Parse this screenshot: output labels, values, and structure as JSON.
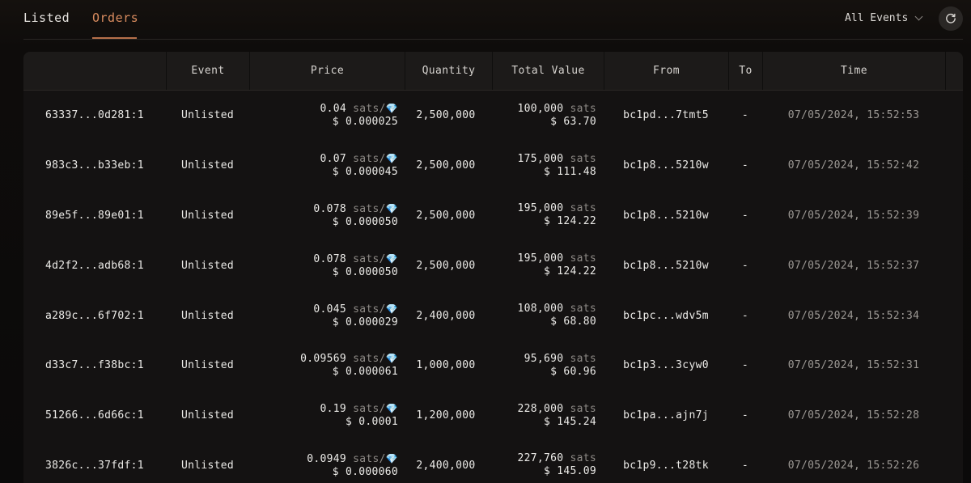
{
  "tabs": [
    {
      "label": "Listed",
      "active": false
    },
    {
      "label": "Orders",
      "active": true
    }
  ],
  "filter": {
    "label": "All Events"
  },
  "colors": {
    "accent": "#d98c5f",
    "underline": "#b6704a",
    "gem": "#7fc3ec"
  },
  "table": {
    "headers": {
      "event": "Event",
      "price": "Price",
      "quantity": "Quantity",
      "total_value": "Total Value",
      "from": "From",
      "to": "To",
      "time": "Time"
    },
    "rows": [
      {
        "id": "63337...0d281:1",
        "event": "Unlisted",
        "price": "0.04",
        "price_unit": "sats/",
        "price_usd": "$ 0.000025",
        "quantity": "2,500,000",
        "total_sats": "100,000",
        "total_unit": "sats",
        "total_usd": "$ 63.70",
        "from": "bc1pd...7tmt5",
        "to": "-",
        "time": "07/05/2024, 15:52:53"
      },
      {
        "id": "983c3...b33eb:1",
        "event": "Unlisted",
        "price": "0.07",
        "price_unit": "sats/",
        "price_usd": "$ 0.000045",
        "quantity": "2,500,000",
        "total_sats": "175,000",
        "total_unit": "sats",
        "total_usd": "$ 111.48",
        "from": "bc1p8...5210w",
        "to": "-",
        "time": "07/05/2024, 15:52:42"
      },
      {
        "id": "89e5f...89e01:1",
        "event": "Unlisted",
        "price": "0.078",
        "price_unit": "sats/",
        "price_usd": "$ 0.000050",
        "quantity": "2,500,000",
        "total_sats": "195,000",
        "total_unit": "sats",
        "total_usd": "$ 124.22",
        "from": "bc1p8...5210w",
        "to": "-",
        "time": "07/05/2024, 15:52:39"
      },
      {
        "id": "4d2f2...adb68:1",
        "event": "Unlisted",
        "price": "0.078",
        "price_unit": "sats/",
        "price_usd": "$ 0.000050",
        "quantity": "2,500,000",
        "total_sats": "195,000",
        "total_unit": "sats",
        "total_usd": "$ 124.22",
        "from": "bc1p8...5210w",
        "to": "-",
        "time": "07/05/2024, 15:52:37"
      },
      {
        "id": "a289c...6f702:1",
        "event": "Unlisted",
        "price": "0.045",
        "price_unit": "sats/",
        "price_usd": "$ 0.000029",
        "quantity": "2,400,000",
        "total_sats": "108,000",
        "total_unit": "sats",
        "total_usd": "$ 68.80",
        "from": "bc1pc...wdv5m",
        "to": "-",
        "time": "07/05/2024, 15:52:34"
      },
      {
        "id": "d33c7...f38bc:1",
        "event": "Unlisted",
        "price": "0.09569",
        "price_unit": "sats/",
        "price_usd": "$ 0.000061",
        "quantity": "1,000,000",
        "total_sats": "95,690",
        "total_unit": "sats",
        "total_usd": "$ 60.96",
        "from": "bc1p3...3cyw0",
        "to": "-",
        "time": "07/05/2024, 15:52:31"
      },
      {
        "id": "51266...6d66c:1",
        "event": "Unlisted",
        "price": "0.19",
        "price_unit": "sats/",
        "price_usd": "$ 0.0001",
        "quantity": "1,200,000",
        "total_sats": "228,000",
        "total_unit": "sats",
        "total_usd": "$ 145.24",
        "from": "bc1pa...ajn7j",
        "to": "-",
        "time": "07/05/2024, 15:52:28"
      },
      {
        "id": "3826c...37fdf:1",
        "event": "Unlisted",
        "price": "0.0949",
        "price_unit": "sats/",
        "price_usd": "$ 0.000060",
        "quantity": "2,400,000",
        "total_sats": "227,760",
        "total_unit": "sats",
        "total_usd": "$ 145.09",
        "from": "bc1p9...t28tk",
        "to": "-",
        "time": "07/05/2024, 15:52:26"
      }
    ]
  }
}
